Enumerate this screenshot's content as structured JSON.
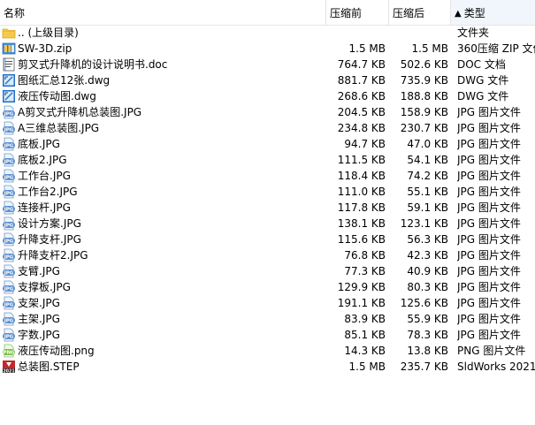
{
  "header": {
    "name": "名称",
    "compressed": "压缩前",
    "size": "压缩后",
    "type": "类型",
    "sort_arrow": "▲"
  },
  "rows": [
    {
      "icon": "folder-up-icon",
      "name": ".. (上级目录)",
      "before": "",
      "after": "",
      "type": "文件夹"
    },
    {
      "icon": "zip-file-icon",
      "name": "SW-3D.zip",
      "before": "1.5 MB",
      "after": "1.5 MB",
      "type": "360压缩 ZIP 文件"
    },
    {
      "icon": "doc-file-icon",
      "name": "剪叉式升降机的设计说明书.doc",
      "before": "764.7 KB",
      "after": "502.6 KB",
      "type": "DOC 文档"
    },
    {
      "icon": "dwg-file-icon",
      "name": "图纸汇总12张.dwg",
      "before": "881.7 KB",
      "after": "735.9 KB",
      "type": "DWG 文件"
    },
    {
      "icon": "dwg-file-icon",
      "name": "液压传动图.dwg",
      "before": "268.6 KB",
      "after": "188.8 KB",
      "type": "DWG 文件"
    },
    {
      "icon": "jpg-file-icon",
      "name": "A剪叉式升降机总装图.JPG",
      "before": "204.5 KB",
      "after": "158.9 KB",
      "type": "JPG 图片文件"
    },
    {
      "icon": "jpg-file-icon",
      "name": "A三维总装图.JPG",
      "before": "234.8 KB",
      "after": "230.7 KB",
      "type": "JPG 图片文件"
    },
    {
      "icon": "jpg-file-icon",
      "name": "底板.JPG",
      "before": "94.7 KB",
      "after": "47.0 KB",
      "type": "JPG 图片文件"
    },
    {
      "icon": "jpg-file-icon",
      "name": "底板2.JPG",
      "before": "111.5 KB",
      "after": "54.1 KB",
      "type": "JPG 图片文件"
    },
    {
      "icon": "jpg-file-icon",
      "name": "工作台.JPG",
      "before": "118.4 KB",
      "after": "74.2 KB",
      "type": "JPG 图片文件"
    },
    {
      "icon": "jpg-file-icon",
      "name": "工作台2.JPG",
      "before": "111.0 KB",
      "after": "55.1 KB",
      "type": "JPG 图片文件"
    },
    {
      "icon": "jpg-file-icon",
      "name": "连接杆.JPG",
      "before": "117.8 KB",
      "after": "59.1 KB",
      "type": "JPG 图片文件"
    },
    {
      "icon": "jpg-file-icon",
      "name": "设计方案.JPG",
      "before": "138.1 KB",
      "after": "123.1 KB",
      "type": "JPG 图片文件"
    },
    {
      "icon": "jpg-file-icon",
      "name": "升降支杆.JPG",
      "before": "115.6 KB",
      "after": "56.3 KB",
      "type": "JPG 图片文件"
    },
    {
      "icon": "jpg-file-icon",
      "name": "升降支杆2.JPG",
      "before": "76.8 KB",
      "after": "42.3 KB",
      "type": "JPG 图片文件"
    },
    {
      "icon": "jpg-file-icon",
      "name": "支臂.JPG",
      "before": "77.3 KB",
      "after": "40.9 KB",
      "type": "JPG 图片文件"
    },
    {
      "icon": "jpg-file-icon",
      "name": "支撑板.JPG",
      "before": "129.9 KB",
      "after": "80.3 KB",
      "type": "JPG 图片文件"
    },
    {
      "icon": "jpg-file-icon",
      "name": "支架.JPG",
      "before": "191.1 KB",
      "after": "125.6 KB",
      "type": "JPG 图片文件"
    },
    {
      "icon": "jpg-file-icon",
      "name": "主架.JPG",
      "before": "83.9 KB",
      "after": "55.9 KB",
      "type": "JPG 图片文件"
    },
    {
      "icon": "jpg-file-icon",
      "name": "字数.JPG",
      "before": "85.1 KB",
      "after": "78.3 KB",
      "type": "JPG 图片文件"
    },
    {
      "icon": "png-file-icon",
      "name": "液压传动图.png",
      "before": "14.3 KB",
      "after": "13.8 KB",
      "type": "PNG 图片文件"
    },
    {
      "icon": "step-file-icon",
      "name": "总装图.STEP",
      "before": "1.5 MB",
      "after": "235.7 KB",
      "type": "SldWorks 2021"
    }
  ],
  "colors": {
    "header_border": "#e5e5e5",
    "sorted_header_bg": "#f0f6fb",
    "folder": "#f6c94a",
    "jpg_icon": "#5b8fd0",
    "dwg_icon": "#1f6fc4",
    "png_icon": "#7cbf4a",
    "step_icon": "#c0282d"
  }
}
